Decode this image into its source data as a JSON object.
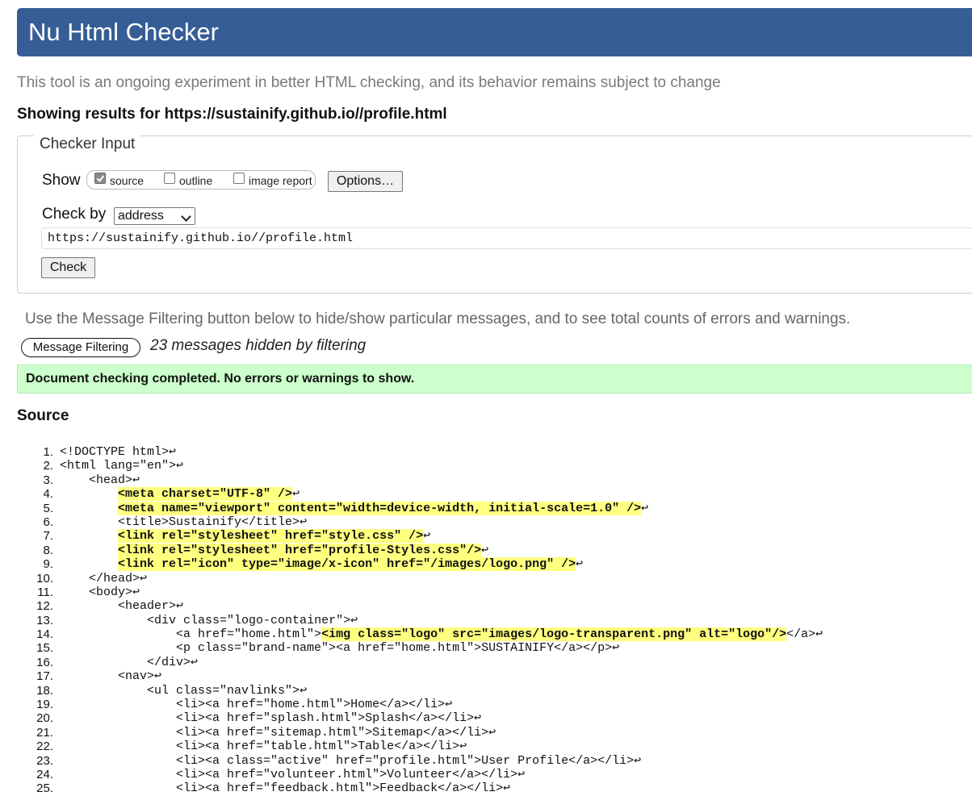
{
  "header": {
    "title": "Nu Html Checker",
    "tagline": "This tool is an ongoing experiment in better HTML checking, and its behavior remains subject to change",
    "results_for": "Showing results for https://sustainify.github.io//profile.html"
  },
  "checker": {
    "legend": "Checker Input",
    "show_label": "Show",
    "show_options": [
      {
        "label": "source",
        "checked": true
      },
      {
        "label": "outline",
        "checked": false
      },
      {
        "label": "image report",
        "checked": false
      }
    ],
    "options_button": "Options…",
    "check_by_label": "Check by",
    "check_by_value": "address",
    "url_value": "https://sustainify.github.io//profile.html",
    "check_button": "Check"
  },
  "filtering": {
    "hint": "Use the Message Filtering button below to hide/show particular messages, and to see total counts of errors and warnings.",
    "button": "Message Filtering",
    "hidden_count": "23 messages hidden by filtering"
  },
  "status": {
    "message": "Document checking completed. No errors or warnings to show.",
    "color": "#ccffcc"
  },
  "source": {
    "heading": "Source",
    "return_glyph": "↩",
    "lines": [
      {
        "n": "1.",
        "indent": "",
        "text": "<!DOCTYPE html>",
        "mark": "",
        "tail": ""
      },
      {
        "n": "2.",
        "indent": "",
        "text": "<html lang=\"en\">",
        "mark": "",
        "tail": ""
      },
      {
        "n": "3.",
        "indent": "    ",
        "text": "<head>",
        "mark": "",
        "tail": ""
      },
      {
        "n": "4.",
        "indent": "        ",
        "text": "",
        "mark": "<meta charset=\"UTF-8\" />",
        "tail": ""
      },
      {
        "n": "5.",
        "indent": "        ",
        "text": "",
        "mark": "<meta name=\"viewport\" content=\"width=device-width, initial-scale=1.0\" />",
        "tail": ""
      },
      {
        "n": "6.",
        "indent": "        ",
        "text": "<title>Sustainify</title>",
        "mark": "",
        "tail": ""
      },
      {
        "n": "7.",
        "indent": "        ",
        "text": "",
        "mark": "<link rel=\"stylesheet\" href=\"style.css\" />",
        "tail": ""
      },
      {
        "n": "8.",
        "indent": "        ",
        "text": "",
        "mark": "<link rel=\"stylesheet\" href=\"profile-Styles.css\"/>",
        "tail": ""
      },
      {
        "n": "9.",
        "indent": "        ",
        "text": "",
        "mark": "<link rel=\"icon\" type=\"image/x-icon\" href=\"/images/logo.png\" />",
        "tail": ""
      },
      {
        "n": "10.",
        "indent": "    ",
        "text": "</head>",
        "mark": "",
        "tail": ""
      },
      {
        "n": "11.",
        "indent": "    ",
        "text": "<body>",
        "mark": "",
        "tail": ""
      },
      {
        "n": "12.",
        "indent": "        ",
        "text": "<header>",
        "mark": "",
        "tail": ""
      },
      {
        "n": "13.",
        "indent": "            ",
        "text": "<div class=\"logo-container\">",
        "mark": "",
        "tail": ""
      },
      {
        "n": "14.",
        "indent": "                ",
        "text": "<a href=\"home.html\">",
        "mark": "<img class=\"logo\" src=\"images/logo-transparent.png\" alt=\"logo\"/>",
        "tail": "</a>"
      },
      {
        "n": "15.",
        "indent": "                ",
        "text": "<p class=\"brand-name\"><a href=\"home.html\">SUSTAINIFY</a></p>",
        "mark": "",
        "tail": ""
      },
      {
        "n": "16.",
        "indent": "            ",
        "text": "</div>",
        "mark": "",
        "tail": ""
      },
      {
        "n": "17.",
        "indent": "        ",
        "text": "<nav>",
        "mark": "",
        "tail": ""
      },
      {
        "n": "18.",
        "indent": "            ",
        "text": "<ul class=\"navlinks\">",
        "mark": "",
        "tail": ""
      },
      {
        "n": "19.",
        "indent": "                ",
        "text": "<li><a href=\"home.html\">Home</a></li>",
        "mark": "",
        "tail": ""
      },
      {
        "n": "20.",
        "indent": "                ",
        "text": "<li><a href=\"splash.html\">Splash</a></li>",
        "mark": "",
        "tail": ""
      },
      {
        "n": "21.",
        "indent": "                ",
        "text": "<li><a href=\"sitemap.html\">Sitemap</a></li>",
        "mark": "",
        "tail": ""
      },
      {
        "n": "22.",
        "indent": "                ",
        "text": "<li><a href=\"table.html\">Table</a></li>",
        "mark": "",
        "tail": ""
      },
      {
        "n": "23.",
        "indent": "                ",
        "text": "<li><a class=\"active\" href=\"profile.html\">User Profile</a></li>",
        "mark": "",
        "tail": ""
      },
      {
        "n": "24.",
        "indent": "                ",
        "text": "<li><a href=\"volunteer.html\">Volunteer</a></li>",
        "mark": "",
        "tail": ""
      },
      {
        "n": "25.",
        "indent": "                ",
        "text": "<li><a href=\"feedback.html\">Feedback</a></li>",
        "mark": "",
        "tail": ""
      }
    ]
  }
}
